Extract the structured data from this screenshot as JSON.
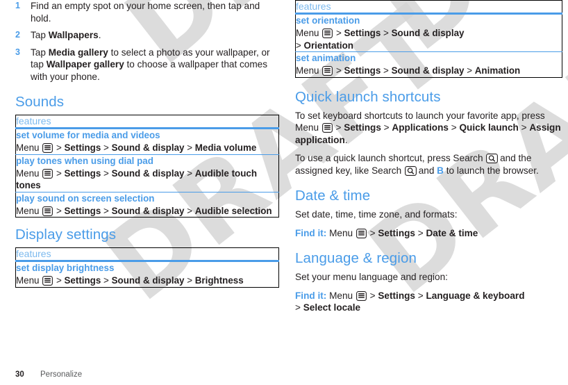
{
  "document": {
    "footer": {
      "page_number": "30",
      "chapter": "Personalize"
    },
    "watermark": "DRAFT"
  },
  "icons": {
    "menu": "menu-key-icon",
    "search": "search-key-icon"
  },
  "left_column": {
    "steps": [
      {
        "num": "1",
        "html": "Find an empty spot on your home screen, then tap and hold."
      },
      {
        "num": "2",
        "html": "Tap <b>Wallpapers</b>."
      },
      {
        "num": "3",
        "html": "Tap <b>Media gallery</b> to select a photo as your wallpaper, or tap <b>Wallpaper gallery</b> to choose a wallpaper that comes with your phone."
      }
    ],
    "sections": [
      {
        "heading": "Sounds",
        "table": {
          "header": "features",
          "rows": [
            {
              "title": "set volume for media and videos",
              "path_html": "Menu {MENU} &gt; <b>Settings</b> &gt; <b>Sound &amp; display</b> &gt; <b>Media volume</b>"
            },
            {
              "title": "play tones when using dial pad",
              "path_html": "Menu {MENU} &gt; <b>Settings</b> &gt; <b>Sound &amp; display</b> &gt; <b>Audible touch tones</b>"
            },
            {
              "title": "play sound on screen selection",
              "path_html": "Menu {MENU} &gt; <b>Settings</b> &gt; <b>Sound &amp; display</b> &gt; <b>Audible selection</b>"
            }
          ]
        }
      },
      {
        "heading": "Display settings",
        "table": {
          "header": "features",
          "rows": [
            {
              "title": "set display brightness",
              "path_html": "Menu {MENU} &gt; <b>Settings</b> &gt; <b>Sound &amp; display</b> &gt; <b>Brightness</b>"
            }
          ]
        }
      }
    ]
  },
  "right_column": {
    "table_top": {
      "header": "features",
      "rows": [
        {
          "title": "set orientation",
          "path_html": "Menu {MENU} &gt; <b>Settings</b> &gt; <b>Sound &amp; display</b><br>&gt; <b>Orientation</b>"
        },
        {
          "title": "set animation",
          "path_html": "Menu {MENU} &gt; <b>Settings</b> &gt; <b>Sound &amp; display</b> &gt; <b>Animation</b>"
        }
      ]
    },
    "sections": [
      {
        "heading": "Quick launch shortcuts",
        "paragraphs": [
          "To set keyboard shortcuts to launch your favorite app, press Menu {MENU} &gt; <b>Settings</b> &gt; <b>Applications</b> &gt; <b>Quick launch</b> &gt; <b>Assign application</b>.",
          "To use a quick launch shortcut, press Search {SEARCH} and the assigned key, like Search {SEARCH} and <span class=\"bluekey\">B</span> to launch the browser."
        ]
      },
      {
        "heading": "Date &amp; time",
        "paragraphs": [
          "Set date, time, time zone, and formats:",
          "<span class=\"findit\">Find it:</span> Menu {MENU} &gt; <b>Settings</b> &gt; <b>Date &amp; time</b>"
        ]
      },
      {
        "heading": "Language &amp; region",
        "paragraphs": [
          "Set your menu language and region:",
          "<span class=\"findit\">Find it:</span> Menu {MENU} &gt; <b>Settings</b> &gt; <b>Language &amp; keyboard</b><br>&gt; <b>Select locale</b>"
        ]
      }
    ]
  },
  "colors": {
    "accent_blue": "#4a9ce8",
    "header_blue": "#7bb9ee",
    "text": "#231f20",
    "watermark_gray": "#d6d6d6"
  }
}
